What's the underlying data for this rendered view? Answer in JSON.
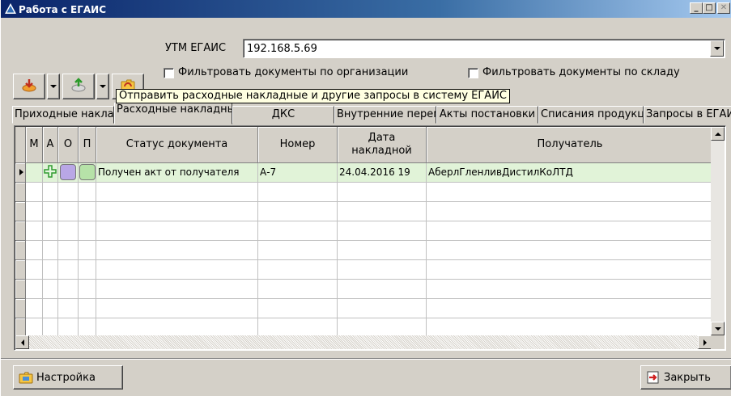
{
  "window": {
    "title": "Работа с ЕГАИС",
    "minimize_glyph": "_",
    "maximize_glyph": "□",
    "close_glyph": "✕"
  },
  "toolbar": {
    "buttons": [
      {
        "icon": "download-orange-icon",
        "has_dropdown": true
      },
      {
        "icon": "upload-green-icon",
        "has_dropdown": true
      },
      {
        "icon": "refresh-folder-icon",
        "has_dropdown": false
      }
    ]
  },
  "utm": {
    "label": "УТМ ЕГАИС",
    "value": "192.168.5.69"
  },
  "filters": {
    "by_org_label": "Фильтровать документы по организации",
    "by_org_checked": false,
    "by_warehouse_label": "Фильтровать документы по складу",
    "by_warehouse_checked": false
  },
  "tooltip": "Отправить расходные накладные и другие запросы в систему ЕГАИС",
  "tabs": [
    {
      "label": "Приходные накладные",
      "active": false
    },
    {
      "label": "Расходные накладные",
      "active": true
    },
    {
      "label": "ДКС",
      "active": false
    },
    {
      "label": "Внутренние перемещения",
      "active": false
    },
    {
      "label": "Акты постановки",
      "active": false
    },
    {
      "label": "Списания продукции",
      "active": false
    },
    {
      "label": "Запросы в ЕГАИС",
      "active": false
    }
  ],
  "grid": {
    "columns": [
      "М",
      "А",
      "О",
      "П",
      "Статус документа",
      "Номер",
      "Дата накладной",
      "Получатель"
    ],
    "rows": [
      {
        "m": "",
        "a_icon": "plus-green-icon",
        "o_color": "#b9a7e6",
        "p_color": "#b6e2a8",
        "status": "Получен акт от получателя",
        "number": "А-7",
        "date": "24.04.2016 19",
        "recipient": "АберлГленливДистилКоЛТД"
      }
    ],
    "empty_rows": 8,
    "selected_row_color": "#e1f3d8"
  },
  "footer": {
    "settings_label": "Настройка",
    "close_label": "Закрыть"
  }
}
